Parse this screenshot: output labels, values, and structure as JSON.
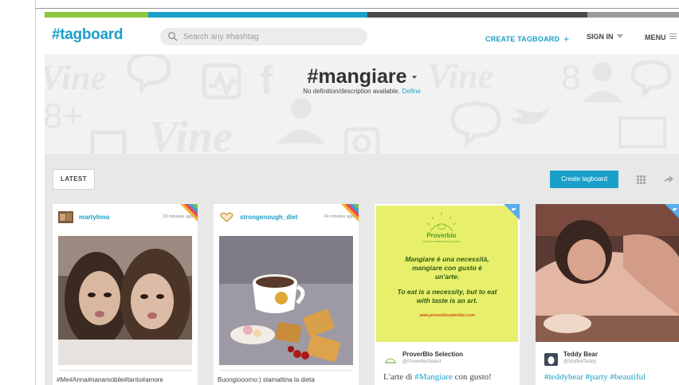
{
  "app": {
    "logo": "#tagboard",
    "search_placeholder": "Search any #hashtag",
    "nav": {
      "create": "CREATE TAGBOARD",
      "signin": "SIGN IN",
      "menu": "MENU"
    },
    "colorbar": [
      "#8dc63f",
      "#1aa0c8",
      "#4a4a4a",
      "#9b9b9b"
    ]
  },
  "hero": {
    "hashtag": "#mangiare",
    "description": "No definition/description available.",
    "define_link": "Define",
    "background_words": [
      "Vine",
      "Vine",
      "Vine"
    ]
  },
  "toolbar": {
    "latest": "LATEST",
    "create_button": "Create tagboard"
  },
  "cards": [
    {
      "network": "instagram",
      "username": "martylnno",
      "time": "33 minutes ago",
      "caption": "#Me#Anna#nanamobile#tanto#amore"
    },
    {
      "network": "instagram",
      "username": "strongenough_diet",
      "time": "34 minutes ago",
      "caption": "Buongiooorno:) stamattina la dieta"
    },
    {
      "network": "twitter",
      "image_title": "Proverbio",
      "image_subtitle": "FRASI DI TRADIZIONE E DI CULTURA",
      "image_text_it": "Mangiare è una necessità, mangiare con gusto è un'arte.",
      "image_text_en": "To eat is a necessity, but to eat with taste is an art.",
      "image_url": "www.proverbioselection.com",
      "name": "ProverBlo Selection",
      "handle": "@ProverbioSelect",
      "text_before": "L'arte di ",
      "text_tag": "#Mangiare",
      "text_after": " con gusto!"
    },
    {
      "network": "twitter",
      "name": "Teddy Bear",
      "handle": "@StuffedTeddy",
      "text": "#teddybear #party #beautiful"
    }
  ]
}
